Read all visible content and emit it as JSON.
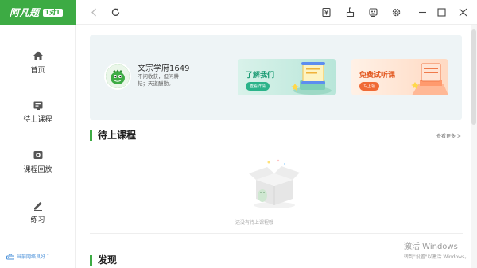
{
  "app": {
    "logo_text": "阿凡题",
    "logo_badge": "1对1"
  },
  "sidebar": {
    "items": [
      {
        "label": "首页",
        "icon": "home-icon"
      },
      {
        "label": "待上课程",
        "icon": "calendar-icon"
      },
      {
        "label": "课程回放",
        "icon": "replay-icon"
      },
      {
        "label": "练习",
        "icon": "pencil-icon"
      }
    ],
    "network_status": "当前网络良好 ˅"
  },
  "topbar": {
    "icons": [
      "back-icon",
      "refresh-icon",
      "wallet-icon",
      "clean-icon",
      "robot-icon",
      "settings-icon",
      "minimize-icon",
      "maximize-icon",
      "close-icon"
    ]
  },
  "profile": {
    "username": "文宗学府1649",
    "motto": "不问收获，但问耕耘；天道酬勤。"
  },
  "cards": {
    "learn": {
      "title": "了解我们",
      "button": "查看详情"
    },
    "trial": {
      "title": "免费试听课",
      "button": "马上领"
    }
  },
  "sections": {
    "upcoming": {
      "title": "待上课程",
      "see_more": "查看更多 >"
    },
    "empty_text": "还没有待上课程哦",
    "discover": {
      "title": "发现"
    }
  },
  "watermark": {
    "line1": "激活 Windows",
    "line2": "转到\"设置\"以激活 Windows。"
  },
  "colors": {
    "brand": "#3dab44",
    "accent_blue": "#4a90d9",
    "learn_green": "#1a9a73",
    "trial_orange": "#e35a22"
  }
}
